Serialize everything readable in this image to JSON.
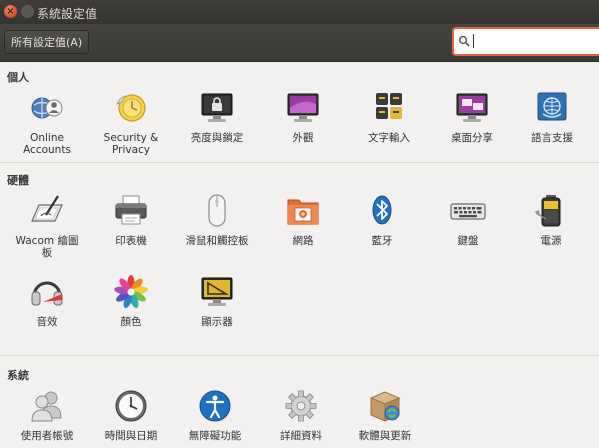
{
  "window": {
    "title": "系統設定值"
  },
  "toolbar": {
    "all_settings_label": "所有設定值(A)",
    "search_value": "",
    "search_placeholder": ""
  },
  "sections": {
    "personal": {
      "title": "個人",
      "items": [
        {
          "label": "Online\nAccounts",
          "icon": "online-accounts-icon"
        },
        {
          "label": "Security &\nPrivacy",
          "icon": "security-privacy-icon"
        },
        {
          "label": "亮度與鎖定",
          "icon": "brightness-lock-icon"
        },
        {
          "label": "外觀",
          "icon": "appearance-icon"
        },
        {
          "label": "文字輸入",
          "icon": "text-entry-icon"
        },
        {
          "label": "桌面分享",
          "icon": "desktop-sharing-icon"
        },
        {
          "label": "語言支援",
          "icon": "language-support-icon"
        }
      ]
    },
    "hardware": {
      "title": "硬體",
      "items": [
        {
          "label": "Wacom 繪圖\n板",
          "icon": "wacom-tablet-icon"
        },
        {
          "label": "印表機",
          "icon": "printer-icon"
        },
        {
          "label": "滑鼠和觸控板",
          "icon": "mouse-touchpad-icon"
        },
        {
          "label": "網路",
          "icon": "network-icon"
        },
        {
          "label": "藍牙",
          "icon": "bluetooth-icon"
        },
        {
          "label": "鍵盤",
          "icon": "keyboard-icon"
        },
        {
          "label": "電源",
          "icon": "power-icon"
        },
        {
          "label": "音效",
          "icon": "sound-icon"
        },
        {
          "label": "顏色",
          "icon": "color-icon"
        },
        {
          "label": "顯示器",
          "icon": "displays-icon"
        }
      ]
    },
    "system": {
      "title": "系統",
      "items": [
        {
          "label": "使用者帳號",
          "icon": "user-accounts-icon"
        },
        {
          "label": "時間與日期",
          "icon": "time-date-icon"
        },
        {
          "label": "無障礙功能",
          "icon": "accessibility-icon"
        },
        {
          "label": "詳細資料",
          "icon": "details-icon"
        },
        {
          "label": "軟體與更新",
          "icon": "software-updates-icon"
        }
      ]
    }
  },
  "colors": {
    "titlebar": "#3c3b37",
    "accent_orange": "#e8643c",
    "background": "#f2f1f0"
  }
}
